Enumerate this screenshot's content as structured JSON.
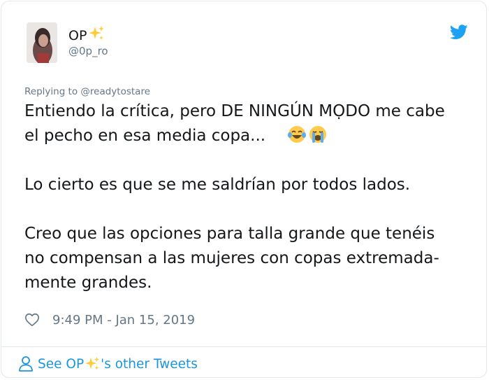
{
  "author": {
    "display_name": "OP",
    "handle": "@0p_ro",
    "name_emoji": "sparkles-emoji"
  },
  "reply": {
    "replying_prefix": "Replying to",
    "replying_to": "@readytostare"
  },
  "tweet": {
    "line1": "Entiendo la crítica, pero DE NINGÚN MỌDO me cabe",
    "line2": "el pecho en esa media copa...",
    "line2_emojis": [
      "tears-of-joy-emoji",
      "loudly-crying-emoji"
    ],
    "line3": "Lo cierto es que se me saldrían por todos lados.",
    "line4": "Creo que las opciones para talla grande que tenéis",
    "line5": "no compensan a las mujeres con copas extremada-",
    "line6": "mente grandes."
  },
  "meta": {
    "timestamp": "9:49 PM - Jan 15, 2019"
  },
  "footer": {
    "see_prefix": "See OP",
    "see_suffix": "'s other Tweets"
  },
  "colors": {
    "text": "#14171a",
    "secondary": "#657786",
    "link": "#1b95e0",
    "twitter_blue": "#1da1f2",
    "border": "#e1e8ed"
  }
}
